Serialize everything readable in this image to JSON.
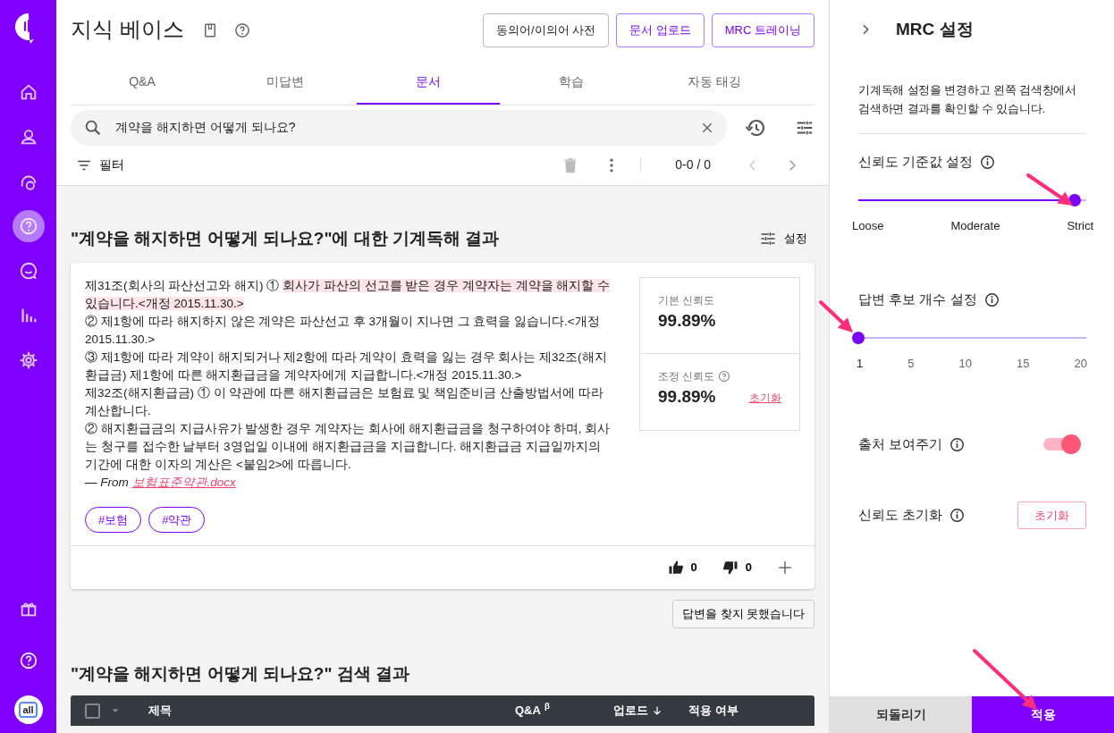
{
  "sidebar": {
    "top_items": [
      {
        "kind": "home",
        "selected": false
      },
      {
        "kind": "user",
        "selected": false
      },
      {
        "kind": "support",
        "selected": false
      },
      {
        "kind": "help",
        "selected": true
      },
      {
        "kind": "chat",
        "selected": false
      },
      {
        "kind": "stats",
        "selected": false
      },
      {
        "kind": "settings",
        "selected": false
      }
    ],
    "bottom_items": [
      {
        "kind": "gift",
        "selected": false
      },
      {
        "kind": "help",
        "selected": false
      }
    ],
    "avatar": "all"
  },
  "header": {
    "title": "지식 베이스",
    "buttons": [
      {
        "label": "동의어/이의어 사전",
        "kind": "default"
      },
      {
        "label": "문서 업로드",
        "kind": "accent"
      },
      {
        "label": "MRC 트레이닝",
        "kind": "accent"
      }
    ]
  },
  "tabs": [
    {
      "label": "Q&A",
      "selected": false
    },
    {
      "label": "미답변",
      "selected": false
    },
    {
      "label": "문서",
      "selected": true
    },
    {
      "label": "학습",
      "selected": false
    },
    {
      "label": "자동 태깅",
      "selected": false
    }
  ],
  "search": {
    "value": "계약을 해지하면 어떻게 되나요?"
  },
  "toolbar": {
    "filter": "필터",
    "pagination": "0-0 / 0"
  },
  "mrc_result": {
    "title": "\"계약을 해지하면 어떻게 되나요?\"에 대한 기계독해 결과",
    "settings": "설정",
    "passage": [
      {
        "text": "제31조(회사의 파산선고와 해지) ① ",
        "highlighted": false
      },
      {
        "text": "회사가 파산의 선고를 받은 경우 계약자는 계약을 해지할 수 있습니다.<개정 2015.11.30.>",
        "highlighted": true
      },
      {
        "text": "\n② 제1항에 따라 해지하지 않은 계약은 파산선고 후 3개월이 지나면 그 효력을 잃습니다.<개정 2015.11.30.>\n③ 제1항에 따라 계약이 해지되거나 제2항에 따라 계약이 효력을 잃는 경우 회사는 제32조(해지환급금) 제1항에 따른 해지환급금을 계약자에게 지급합니다.<개정 2015.11.30.>\n제32조(해지환급금) ① 이 약관에 따른 해지환급금은 보험료 및 책임준비금 산출방법서에 따라 계산합니다.\n② 해지환급금의 지급사유가 발생한 경우 계약자는 회사에 해지환급금을 청구하여야 하며, 회사는 청구를 접수한 날부터 3영업일 이내에 해지환급금을 지급합니다. 해지환급금 지급일까지의 기간에 대한 이자의 계산은 <붙임2>에 따릅니다.",
        "highlighted": false
      }
    ],
    "source_prefix": "— From",
    "source_file": "보험표준약관.docx",
    "tags": [
      "#보험",
      "#약관"
    ],
    "base_confidence": {
      "label": "기본 신뢰도",
      "value": "99.89%"
    },
    "adjusted_confidence": {
      "label": "조정 신뢰도",
      "value": "99.89%",
      "reset": "초기화"
    },
    "likes": "0",
    "dislikes": "0",
    "not_found_button": "답변을 찾지 못했습니다"
  },
  "search_results": {
    "title": "\"계약을 해지하면 어떻게 되나요?\" 검색 결과",
    "select_all_checked": false,
    "columns": [
      {
        "label": "제목",
        "sorted": false
      },
      {
        "label": "Q&A $^{β}$",
        "sorted": false
      },
      {
        "label": "업로드",
        "sorted": true
      },
      {
        "label": "적용 여부",
        "sorted": false
      }
    ]
  },
  "panel": {
    "title": "MRC 설정",
    "description": "기계독해 설정을 변경하고 왼쪽 검색창에서 검색하면 결과를 확인할 수 있습니다.",
    "threshold": {
      "label": "신뢰도 기준값 설정",
      "level": 0.95,
      "marks": [
        "Loose",
        "Moderate",
        "Strict"
      ]
    },
    "candidates": {
      "label": "답변 후보 개수 설정",
      "level": 0,
      "marks": [
        "1",
        "5",
        "10",
        "15",
        "20"
      ]
    },
    "show_source": {
      "label": "출처 보여주기",
      "on": true
    },
    "reset": {
      "label": "신뢰도 초기화",
      "button": "초기화"
    },
    "footer": {
      "revert": "되돌리기",
      "apply": "적용"
    }
  }
}
